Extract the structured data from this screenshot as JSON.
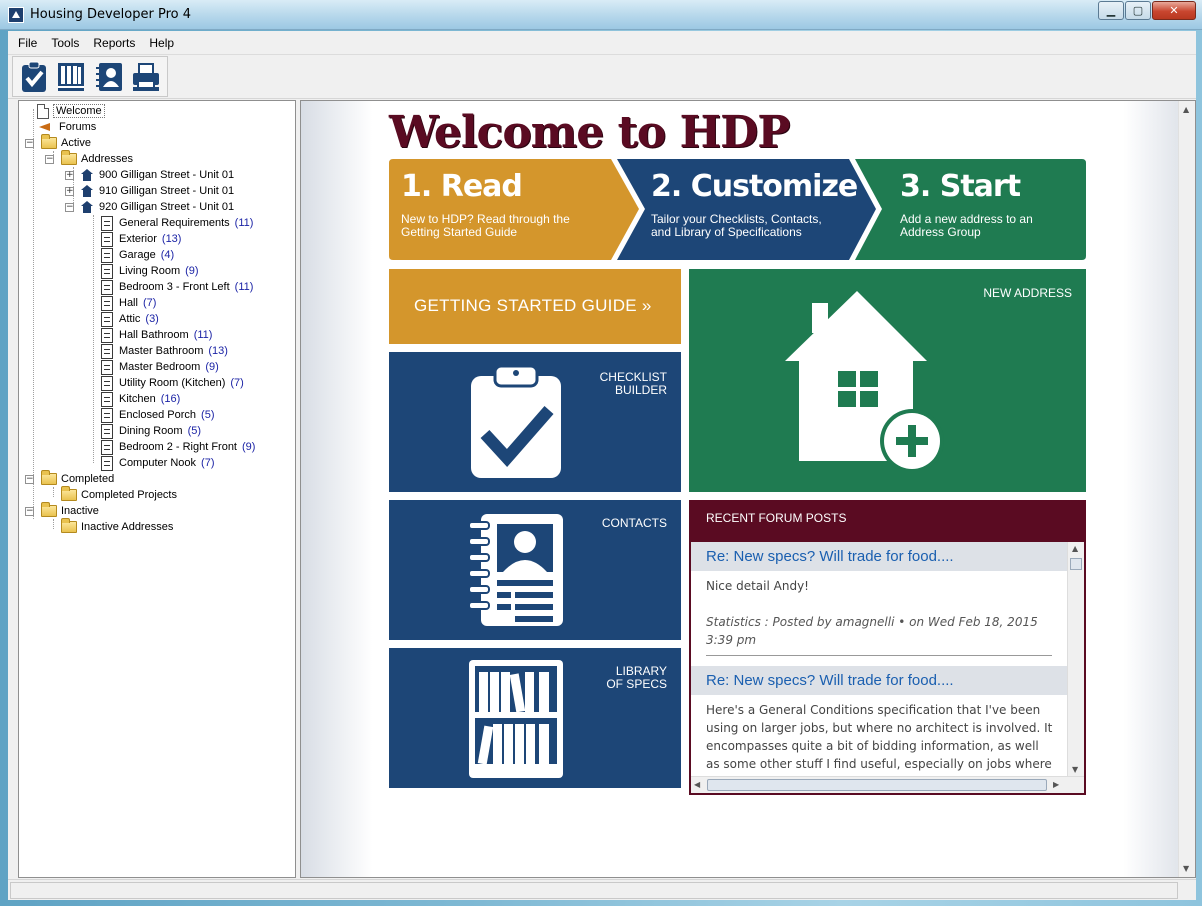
{
  "window": {
    "title": "Housing Developer Pro 4",
    "controls": {
      "minimize": "▁",
      "maximize": "▢",
      "close": "✕"
    }
  },
  "menu": [
    "File",
    "Tools",
    "Reports",
    "Help"
  ],
  "toolbar": [
    {
      "icon": "checklist-icon"
    },
    {
      "icon": "library-icon"
    },
    {
      "icon": "contacts-icon"
    },
    {
      "icon": "printer-icon"
    }
  ],
  "tree": {
    "welcome": "Welcome",
    "forums": "Forums",
    "active": "Active",
    "addresses": "Addresses",
    "address_items": [
      "900 Gilligan Street - Unit 01",
      "910 Gilligan Street - Unit 01",
      "920 Gilligan Street - Unit 01"
    ],
    "rooms": [
      {
        "label": "General Requirements",
        "count": "(11)"
      },
      {
        "label": "Exterior",
        "count": "(13)"
      },
      {
        "label": "Garage",
        "count": "(4)"
      },
      {
        "label": "Living Room",
        "count": "(9)"
      },
      {
        "label": "Bedroom 3 - Front Left",
        "count": "(11)"
      },
      {
        "label": "Hall",
        "count": "(7)"
      },
      {
        "label": "Attic",
        "count": "(3)"
      },
      {
        "label": "Hall Bathroom",
        "count": "(11)"
      },
      {
        "label": "Master Bathroom",
        "count": "(13)"
      },
      {
        "label": "Master Bedroom",
        "count": "(9)"
      },
      {
        "label": "Utility Room (Kitchen)",
        "count": "(7)"
      },
      {
        "label": "Kitchen",
        "count": "(16)"
      },
      {
        "label": "Enclosed Porch",
        "count": "(5)"
      },
      {
        "label": "Dining Room",
        "count": "(5)"
      },
      {
        "label": "Bedroom 2 - Right Front",
        "count": "(9)"
      },
      {
        "label": "Computer Nook",
        "count": "(7)"
      }
    ],
    "completed": "Completed",
    "completed_projects": "Completed Projects",
    "inactive": "Inactive",
    "inactive_addresses": "Inactive Addresses"
  },
  "welcome": {
    "title": "Welcome to HDP",
    "steps": [
      {
        "num": "1. Read",
        "desc1": "New to HDP? Read through the",
        "desc2": "Getting Started Guide"
      },
      {
        "num": "2. Customize",
        "desc1": "Tailor your Checklists, Contacts,",
        "desc2": "and Library of Specifications"
      },
      {
        "num": "3. Start",
        "desc1": "Add a new address to an",
        "desc2": "Address Group"
      }
    ],
    "getting_started": "GETTING STARTED GUIDE »",
    "new_address": "NEW ADDRESS",
    "checklist_builder_1": "CHECKLIST",
    "checklist_builder_2": "BUILDER",
    "contacts": "CONTACTS",
    "library_1": "LIBRARY",
    "library_2": "OF SPECS",
    "recent_forum": "RECENT FORUM POSTS",
    "posts": [
      {
        "title": "Re: New specs? Will trade for food....",
        "body": "Nice detail Andy!",
        "meta": "Statistics : Posted by amagnelli • on Wed Feb 18, 2015 3:39 pm"
      },
      {
        "title": "Re: New specs? Will trade for food....",
        "body": "Here's a General Conditions specification that I've been using on larger jobs, but where no architect is involved. It encompasses quite a bit of bidding information, as well as some other stuff I find useful, especially on jobs where we"
      }
    ]
  },
  "colors": {
    "gold": "#d4962c",
    "navy": "#1d4677",
    "green": "#1f7b51",
    "maroon": "#5a0b22",
    "link": "#1a5fb0"
  }
}
